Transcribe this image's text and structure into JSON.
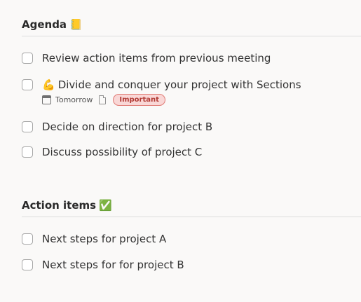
{
  "sections": [
    {
      "title": "Agenda",
      "emoji": "📒",
      "tasks": [
        {
          "content": "Review action items from previous meeting"
        },
        {
          "emoji": "💪",
          "content": "Divide and conquer your project with Sections",
          "due": "Tomorrow",
          "label": {
            "text": "Important",
            "bg": "#f9d7d6",
            "color": "#b23b35",
            "border": "#e07b75"
          }
        },
        {
          "content": "Decide on direction for project B"
        },
        {
          "content": "Discuss possibility of project C"
        }
      ]
    },
    {
      "title": "Action items",
      "emoji": "✅",
      "tasks": [
        {
          "content": "Next steps for project A"
        },
        {
          "content": "Next steps for for project B"
        }
      ]
    }
  ],
  "icons": {
    "due": "calendar-icon",
    "note": "note-icon"
  },
  "colors": {
    "background": "#faf9f8",
    "checkbox_border": "#a7a7a7",
    "divider": "#dddddd"
  }
}
